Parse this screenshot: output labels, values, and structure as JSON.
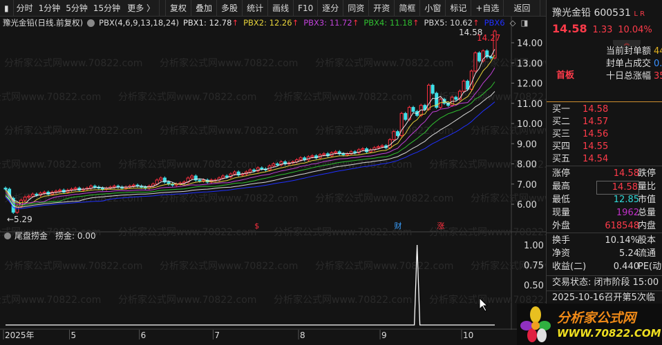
{
  "toolbar": {
    "layout_toggle": "▮",
    "periods": [
      "分时",
      "1分钟",
      "5分钟",
      "15分钟",
      "更多 〉"
    ],
    "buttons": [
      "复权",
      "叠加",
      "多股",
      "统计",
      "画线",
      "F10",
      "逐分",
      "同资",
      "开资",
      "简框",
      "小窗",
      "标记",
      "+自选",
      "返回"
    ]
  },
  "legend": {
    "title": "豫光金铅(日线.前复权)",
    "indicator": "PBX(4,6,9,13,18,24)",
    "items": [
      {
        "label": "PBX1: 12.78",
        "color": "#e8e8e8"
      },
      {
        "label": "PBX2: 12.26",
        "color": "#e6d23a"
      },
      {
        "label": "PBX3: 11.72",
        "color": "#c040d8"
      },
      {
        "label": "PBX4: 11.18",
        "color": "#30c030"
      },
      {
        "label": "PBX5: 10.62",
        "color": "#d8d8d8"
      },
      {
        "label": "PBX6",
        "color": "#2030ff"
      }
    ],
    "arrow": "↑"
  },
  "chart_data": {
    "type": "candlestick",
    "y_ticks": [
      "14.00",
      "13.00",
      "12.00",
      "11.00",
      "10.00",
      "9.00",
      "8.00",
      "7.00",
      "6.00"
    ],
    "ylim": [
      5.0,
      14.9
    ],
    "x_ticks": [
      {
        "label": "2025年",
        "bar": 0
      },
      {
        "label": "5",
        "bar": 17
      },
      {
        "label": "6",
        "bar": 35
      },
      {
        "label": "7",
        "bar": 54
      },
      {
        "label": "8",
        "bar": 76
      },
      {
        "label": "9",
        "bar": 97
      },
      {
        "label": "10",
        "bar": 118
      }
    ],
    "closes": [
      6.75,
      6.3,
      5.6,
      5.9,
      6.2,
      6.35,
      6.4,
      6.5,
      6.45,
      6.55,
      6.6,
      6.5,
      6.6,
      6.65,
      6.7,
      6.6,
      6.7,
      6.75,
      6.8,
      6.7,
      6.75,
      6.8,
      6.9,
      6.85,
      6.8,
      6.75,
      6.8,
      6.85,
      6.9,
      6.85,
      6.8,
      6.85,
      6.9,
      6.95,
      6.9,
      6.85,
      6.8,
      6.9,
      7.0,
      7.2,
      7.3,
      7.1,
      7.0,
      6.95,
      7.0,
      7.05,
      7.1,
      7.3,
      7.4,
      7.2,
      7.15,
      7.2,
      7.1,
      7.2,
      7.2,
      7.3,
      7.4,
      7.35,
      7.5,
      7.6,
      7.45,
      7.5,
      7.6,
      7.7,
      7.65,
      7.8,
      7.75,
      7.7,
      7.9,
      8.0,
      7.95,
      8.1,
      8.0,
      8.05,
      8.1,
      8.2,
      8.3,
      8.2,
      8.35,
      8.4,
      8.3,
      8.45,
      8.5,
      8.4,
      8.55,
      8.6,
      8.5,
      8.45,
      8.5,
      8.6,
      8.55,
      8.7,
      8.75,
      8.6,
      8.7,
      8.8,
      8.85,
      8.9,
      8.8,
      9.2,
      9.6,
      9.4,
      10.5,
      10.2,
      10.8,
      10.6,
      10.4,
      10.9,
      10.7,
      11.9,
      11.5,
      10.8,
      11.2,
      11.0,
      10.9,
      11.3,
      11.2,
      11.6,
      12.1,
      11.7,
      12.6,
      13.5,
      13.1,
      13.6,
      13.3,
      13.25,
      14.58
    ],
    "ma_periods": [
      4,
      6,
      9,
      13,
      18,
      24
    ],
    "high_label": "14.58",
    "low_label": "5.29",
    "last_label": "14.27",
    "markers": [
      {
        "text": "$",
        "bar": 65,
        "color": "#ff3040"
      },
      {
        "text": "财",
        "bar": 101,
        "color": "#3aa0ff"
      },
      {
        "text": "涨",
        "bar": 112,
        "color": "#ff3040"
      }
    ],
    "sub": {
      "title": "尾盘捞金",
      "value_label": "捞金: 0.00",
      "y_ticks": [
        "1.00",
        "0.75",
        "0.50"
      ],
      "ylim": [
        0,
        1.05
      ],
      "spikes": [
        {
          "bar": 106,
          "value": 1.0
        }
      ]
    }
  },
  "quote": {
    "name": "豫光金铅",
    "code": "600531",
    "flags": "L R",
    "price": "14.58",
    "change": "1.33",
    "pct": "10.04%",
    "seal": [
      {
        "k": "当前封单额",
        "v": "44"
      },
      {
        "k": "封单占成交",
        "v": "0."
      },
      {
        "k": "十日总涨幅",
        "v": "35"
      }
    ],
    "tag": "首板",
    "bids": [
      {
        "k": "买一",
        "v": "14.58"
      },
      {
        "k": "买二",
        "v": "14.57"
      },
      {
        "k": "买三",
        "v": "14.56"
      },
      {
        "k": "买四",
        "v": "14.55"
      },
      {
        "k": "买五",
        "v": "14.54"
      }
    ],
    "stats": [
      {
        "k": "涨停",
        "v": "14.58",
        "c": "#ff3b4a",
        "k2": "跌停"
      },
      {
        "k": "最高",
        "v": "14.58",
        "c": "#ff3b4a",
        "k2": "量比"
      },
      {
        "k": "最低",
        "v": "12.85",
        "c": "#30d8d8",
        "k2": "市值"
      },
      {
        "k": "现量",
        "v": "1962",
        "c": "#c030c8",
        "k2": "总量"
      },
      {
        "k": "外盘",
        "v": "618548",
        "c": "#ff3b4a",
        "k2": "内盘"
      }
    ],
    "fund": [
      {
        "k": "换手",
        "v": "10.14%",
        "k2": "股本"
      },
      {
        "k": "净资",
        "v": "5.24",
        "k2": "流通"
      },
      {
        "k": "收益(二)",
        "v": "0.440",
        "k2": "PE(动)"
      }
    ],
    "status": "交易状态: 闭市阶段 15:00",
    "notice": "2025-10-16召开第5次临"
  },
  "logo": {
    "text": "分析家公式网",
    "url": "WWW.70822.COM"
  },
  "watermark": "分析家公式网www.70822.com"
}
